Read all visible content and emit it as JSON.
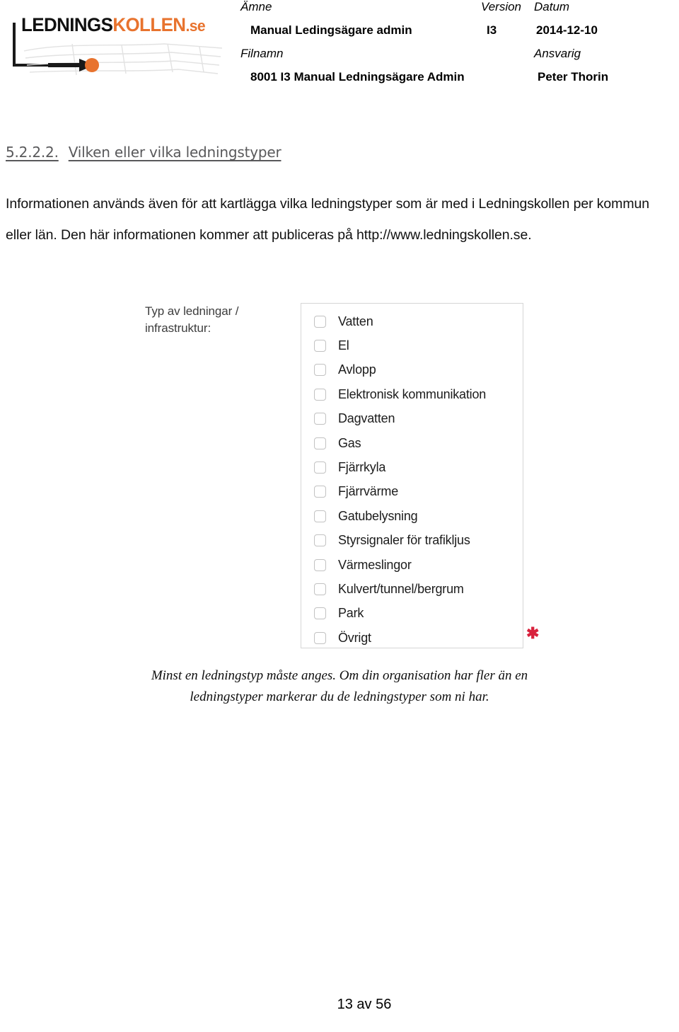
{
  "header": {
    "logo": {
      "text_black": "LEDNINGS",
      "text_orange": "KOLLEN",
      "text_suffix": ".se",
      "brand_color": "#E8732E",
      "dark_color": "#111111"
    },
    "table": {
      "label_amne": "Ämne",
      "label_version": "Version",
      "label_datum": "Datum",
      "value_amne": "Manual Ledingsägare admin",
      "value_version": "I3",
      "value_datum": "2014-12-10",
      "label_filnamn": "Filnamn",
      "label_ansvarig": "Ansvarig",
      "value_filnamn": "8001 I3 Manual Ledningsägare Admin",
      "value_ansvarig": "Peter Thorin"
    }
  },
  "section": {
    "number": "5.2.2.2.",
    "title": "Vilken eller vilka ledningstyper",
    "body": "Informationen används även för att kartlägga vilka ledningstyper som är med i Ledningskollen per kommun eller län. Den här informationen kommer att publiceras på http://www.ledningskollen.se."
  },
  "figure": {
    "field_label": "Typ av ledningar / infrastruktur:",
    "required_marker": "✱",
    "required_color": "#d8213c",
    "checkboxes": [
      {
        "label": "Vatten",
        "checked": false
      },
      {
        "label": "El",
        "checked": false
      },
      {
        "label": "Avlopp",
        "checked": false
      },
      {
        "label": "Elektronisk kommunikation",
        "checked": false
      },
      {
        "label": "Dagvatten",
        "checked": false
      },
      {
        "label": "Gas",
        "checked": false
      },
      {
        "label": "Fjärrkyla",
        "checked": false
      },
      {
        "label": "Fjärrvärme",
        "checked": false
      },
      {
        "label": "Gatubelysning",
        "checked": false
      },
      {
        "label": "Styrsignaler för trafikljus",
        "checked": false
      },
      {
        "label": "Värmeslingor",
        "checked": false
      },
      {
        "label": "Kulvert/tunnel/bergrum",
        "checked": false
      },
      {
        "label": "Park",
        "checked": false
      },
      {
        "label": "Övrigt",
        "checked": false
      }
    ],
    "caption": "Minst en ledningstyp måste anges. Om din organisation har fler än en ledningstyper markerar du de ledningstyper som ni har."
  },
  "footer": {
    "page_label": "13 av 56"
  }
}
